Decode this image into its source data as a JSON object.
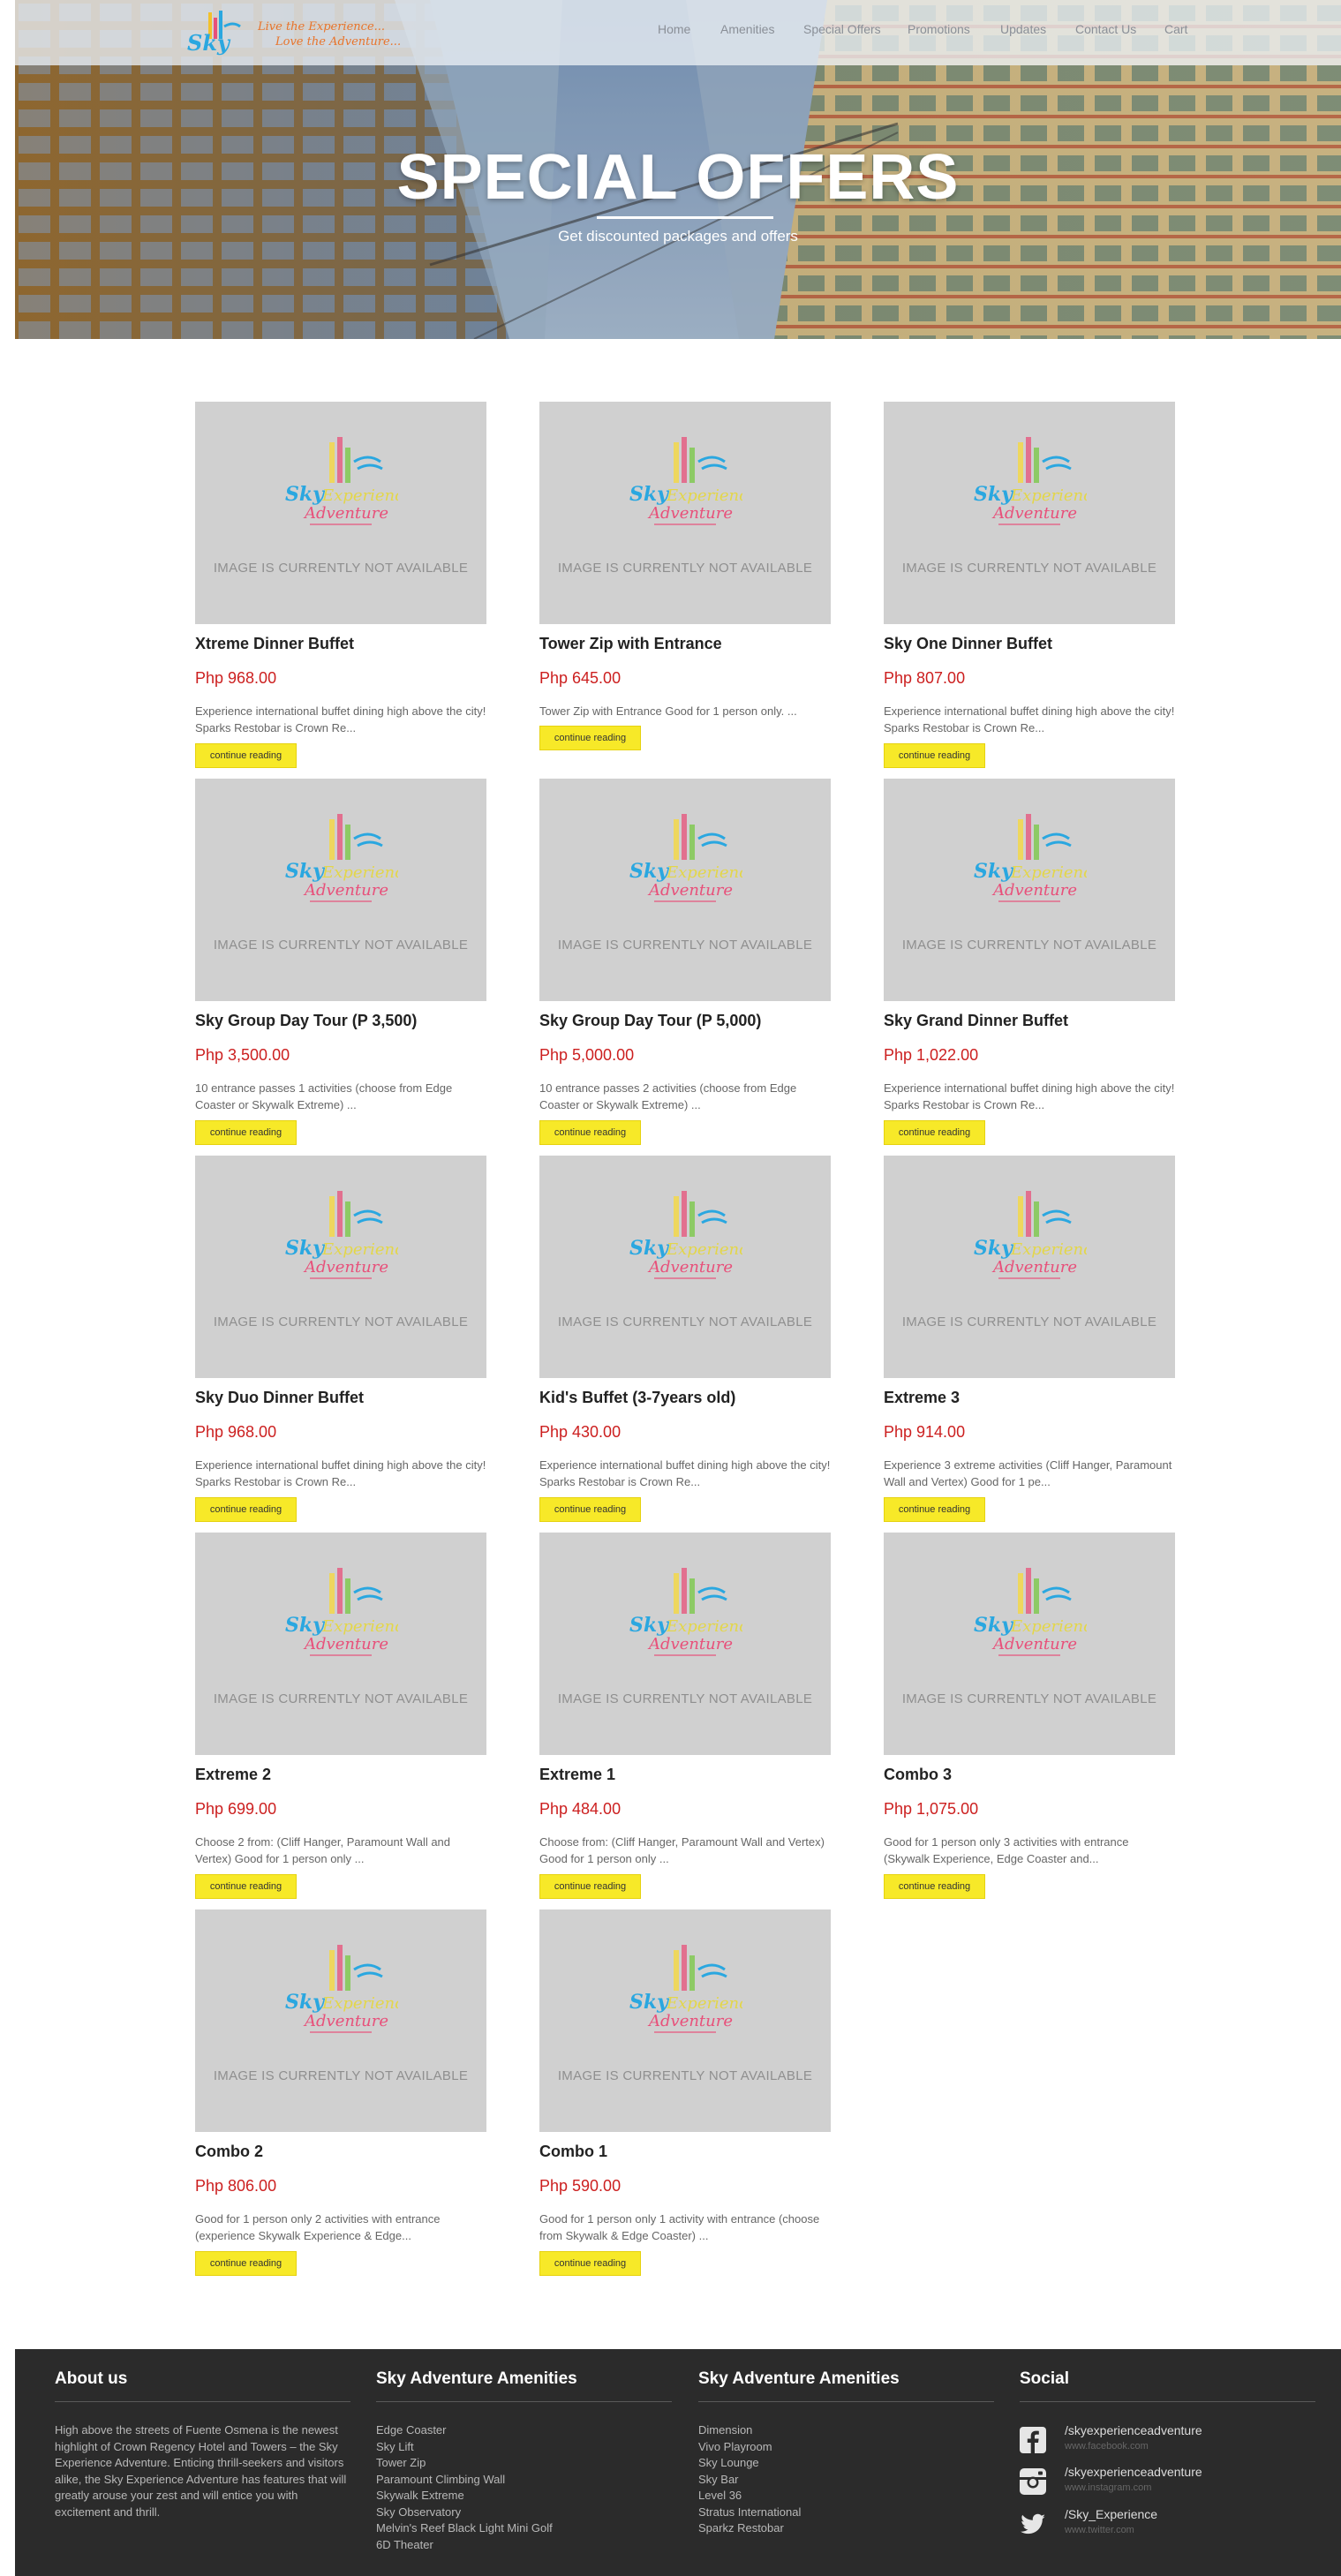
{
  "brand": {
    "logo_text": "Sky",
    "tagline_1": "Live the Experience...",
    "tagline_2": "Love the Adventure..."
  },
  "nav": {
    "items": [
      {
        "label": "Home"
      },
      {
        "label": "Amenities"
      },
      {
        "label": "Special Offers"
      },
      {
        "label": "Promotions"
      },
      {
        "label": "Updates"
      },
      {
        "label": "Contact Us"
      },
      {
        "label": "Cart"
      }
    ]
  },
  "hero": {
    "title": "SPECIAL OFFERS",
    "subtitle": "Get discounted packages and offers"
  },
  "placeholder": {
    "brand_1": "Sky",
    "brand_2": "Experience",
    "brand_3": "Adventure",
    "text": "IMAGE IS CURRENTLY NOT AVAILABLE"
  },
  "offers": [
    {
      "title": "Xtreme Dinner Buffet",
      "price": "Php 968.00",
      "desc": "Experience international buffet dining high above the city! Sparks Restobar is Crown Re...",
      "button": "continue reading"
    },
    {
      "title": "Tower Zip with Entrance",
      "price": "Php 645.00",
      "desc": "Tower Zip with Entrance Good for 1 person only. ...",
      "button": "continue reading"
    },
    {
      "title": "Sky One Dinner Buffet",
      "price": "Php 807.00",
      "desc": "Experience international buffet dining high above the city! Sparks Restobar is Crown Re...",
      "button": "continue reading"
    },
    {
      "title": "Sky Group Day Tour (P 3,500)",
      "price": "Php 3,500.00",
      "desc": "10 entrance passes 1 activities (choose from Edge Coaster or Skywalk Extreme) ...",
      "button": "continue reading"
    },
    {
      "title": "Sky Group Day Tour (P 5,000)",
      "price": "Php 5,000.00",
      "desc": "10 entrance passes 2 activities (choose from Edge Coaster or Skywalk Extreme) ...",
      "button": "continue reading"
    },
    {
      "title": "Sky Grand Dinner Buffet",
      "price": "Php 1,022.00",
      "desc": "Experience international buffet dining high above the city! Sparks Restobar is Crown Re...",
      "button": "continue reading"
    },
    {
      "title": "Sky Duo Dinner Buffet",
      "price": "Php 968.00",
      "desc": "Experience international buffet dining high above the city! Sparks Restobar is Crown Re...",
      "button": "continue reading"
    },
    {
      "title": "Kid's Buffet (3-7years old)",
      "price": "Php 430.00",
      "desc": "Experience international buffet dining high above the city! Sparks Restobar is Crown Re...",
      "button": "continue reading"
    },
    {
      "title": "Extreme 3",
      "price": "Php 914.00",
      "desc": "Experience 3 extreme activities (Cliff Hanger, Paramount Wall and Vertex) Good for 1 pe...",
      "button": "continue reading"
    },
    {
      "title": "Extreme 2",
      "price": "Php 699.00",
      "desc": "Choose 2 from: (Cliff Hanger, Paramount Wall and Vertex) Good for 1 person only ...",
      "button": "continue reading"
    },
    {
      "title": "Extreme 1",
      "price": "Php 484.00",
      "desc": "Choose from: (Cliff Hanger, Paramount Wall and Vertex) Good for 1 person only ...",
      "button": "continue reading"
    },
    {
      "title": "Combo 3",
      "price": "Php 1,075.00",
      "desc": "Good for 1 person only 3 activities with entrance (Skywalk Experience, Edge Coaster and...",
      "button": "continue reading"
    },
    {
      "title": "Combo 2",
      "price": "Php 806.00",
      "desc": "Good for 1 person only 2 activities with entrance (experience Skywalk Experience & Edge...",
      "button": "continue reading"
    },
    {
      "title": "Combo 1",
      "price": "Php 590.00",
      "desc": "Good for 1 person only 1 activity with entrance (choose from Skywalk & Edge Coaster) ...",
      "button": "continue reading"
    }
  ],
  "footer": {
    "about": {
      "heading": "About us",
      "text": "High above the streets of Fuente Osmena is the newest highlight of Crown Regency Hotel and Towers – the Sky Experience Adventure. Enticing thrill-seekers and visitors alike, the Sky Experience Adventure has features that will greatly arouse your zest and will entice you with excitement and thrill."
    },
    "amenities_1": {
      "heading": "Sky Adventure Amenities",
      "items": [
        "Edge Coaster",
        "Sky Lift",
        "Tower Zip",
        "Paramount Climbing Wall",
        "Skywalk Extreme",
        "Sky Observatory",
        "Melvin's Reef Black Light Mini Golf",
        "6D Theater"
      ]
    },
    "amenities_2": {
      "heading": "Sky Adventure Amenities",
      "items": [
        "Dimension",
        "Vivo Playroom",
        "Sky Lounge",
        "Sky Bar",
        "Level 36",
        "Stratus International",
        "Sparkz Restobar"
      ]
    },
    "social": {
      "heading": "Social",
      "links": [
        {
          "icon": "facebook-icon",
          "handle": "/skyexperienceadventure",
          "url": "www.facebook.com"
        },
        {
          "icon": "instagram-icon",
          "handle": "/skyexperienceadventure",
          "url": "www.instagram.com"
        },
        {
          "icon": "twitter-icon",
          "handle": "/Sky_Experience",
          "url": "www.twitter.com"
        }
      ]
    }
  },
  "colors": {
    "accent_button": "#f7e928",
    "price": "#cc1f1f",
    "footer_bg": "#2b2b2b",
    "placeholder_bg": "#d0d0d0"
  }
}
